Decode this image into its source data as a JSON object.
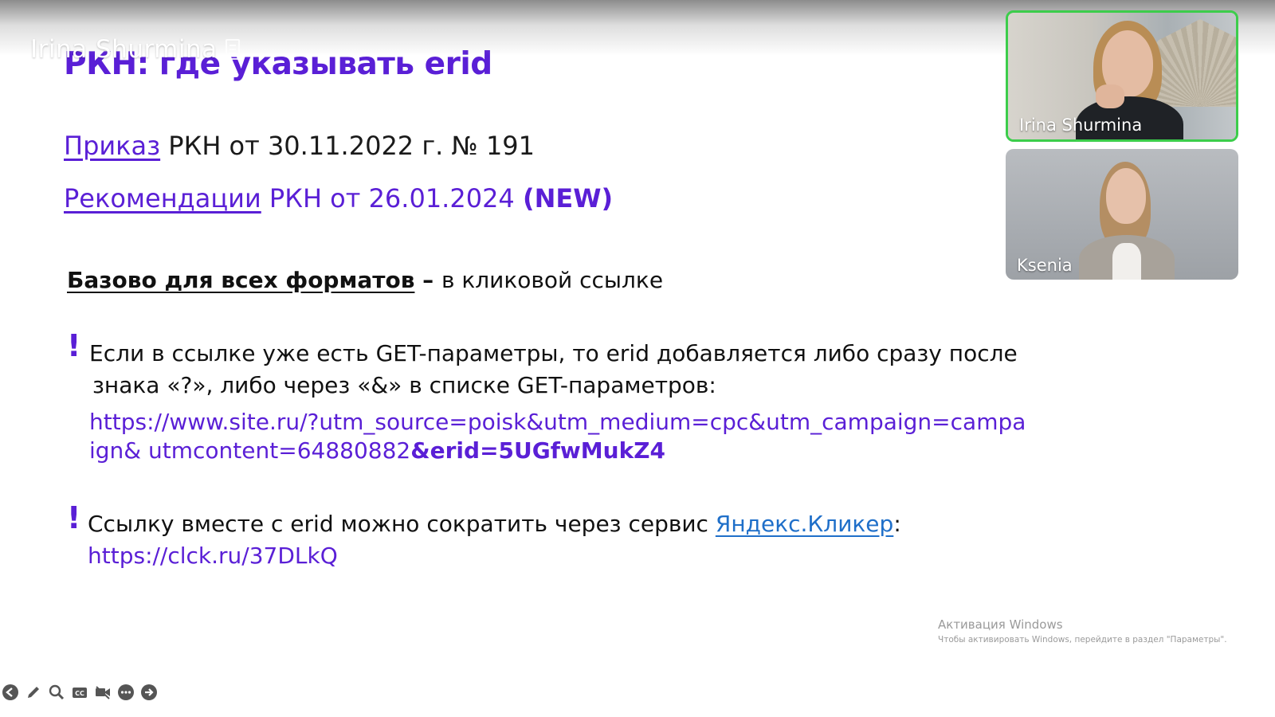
{
  "overlay": {
    "speaker_name": "Irina Shurmina"
  },
  "slide": {
    "title": "РКН: где указывать erid",
    "line1": {
      "link": "Приказ",
      "rest": " РКН от 30.11.2022 г. № 191"
    },
    "line2": {
      "link": "Рекомендации",
      "rest": " РКН от 26.01.2024 ",
      "bold": "(NEW)"
    },
    "base": {
      "bold": "Базово для всех форматов",
      "dash": " – ",
      "rest": "в кликовой ссылке"
    },
    "bullet_mark": "!",
    "block1": {
      "line_a": "Если в ссылке уже есть GET-параметры, то erid добавляется либо сразу после",
      "line_b": "знака «?», либо через «&» в списке GET-параметров:",
      "url_main": "https://www.site.ru/?utm_source=poisk&utm_medium=cpc&utm_campaign=campaign& utmcontent=64880882",
      "url_bold": "&erid=5UGfwMukZ4"
    },
    "block2": {
      "text": "Ссылку вместе с erid можно сократить через сервис ",
      "link": "Яндекс.Кликер",
      "colon": ":",
      "url": "https://clck.ru/37DLkQ"
    }
  },
  "participants": [
    {
      "name": "Irina Shurmina",
      "active": true
    },
    {
      "name": "Ksenia",
      "active": false
    }
  ],
  "watermark": {
    "line1": "Активация Windows",
    "line2": "Чтобы активировать Windows, перейдите в раздел \"Параметры\"."
  },
  "toolbar": {
    "icons": [
      "back-icon",
      "pen-icon",
      "zoom-icon",
      "captions-icon",
      "camera-icon",
      "more-icon",
      "forward-icon"
    ]
  },
  "colors": {
    "accent": "#5a1fd6",
    "link_blue": "#1f6fc9",
    "active_border": "#3ccd4b"
  }
}
